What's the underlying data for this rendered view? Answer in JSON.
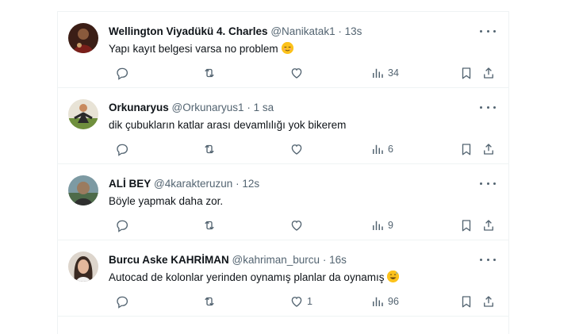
{
  "tweets": [
    {
      "display_name": "Wellington Viyadükü 4. Charles",
      "handle": "@Nanikatak1",
      "separator": "·",
      "time": "13s",
      "text": "Yapı kayıt belgesi varsa no problem",
      "emoji": "relieved-face",
      "likes": "",
      "views": "34"
    },
    {
      "display_name": "Orkunaryus",
      "handle": "@Orkunaryus1",
      "separator": "·",
      "time": "1 sa",
      "text": "dik çubukların katlar arası devamlılığı yok bikerem",
      "emoji": "",
      "likes": "",
      "views": "6"
    },
    {
      "display_name": "ALİ BEY",
      "handle": "@4karakteruzun",
      "separator": "·",
      "time": "12s",
      "text": "Böyle yapmak daha zor.",
      "emoji": "",
      "likes": "",
      "views": "9"
    },
    {
      "display_name": "Burcu Aske KAHRİMAN",
      "handle": "@kahriman_burcu",
      "separator": "·",
      "time": "16s",
      "text": "Autocad de kolonlar yerinden oynamış planlar da oynamış",
      "emoji": "grinning-sweat-face",
      "likes": "1",
      "views": "96"
    }
  ],
  "colors": {
    "text_primary": "#0f1419",
    "text_secondary": "#536471",
    "divider": "#eff3f4"
  },
  "icons": {
    "reply": "reply-icon",
    "retweet": "retweet-icon",
    "like": "like-icon",
    "views": "views-icon",
    "bookmark": "bookmark-icon",
    "share": "share-icon",
    "more": "more-icon"
  }
}
